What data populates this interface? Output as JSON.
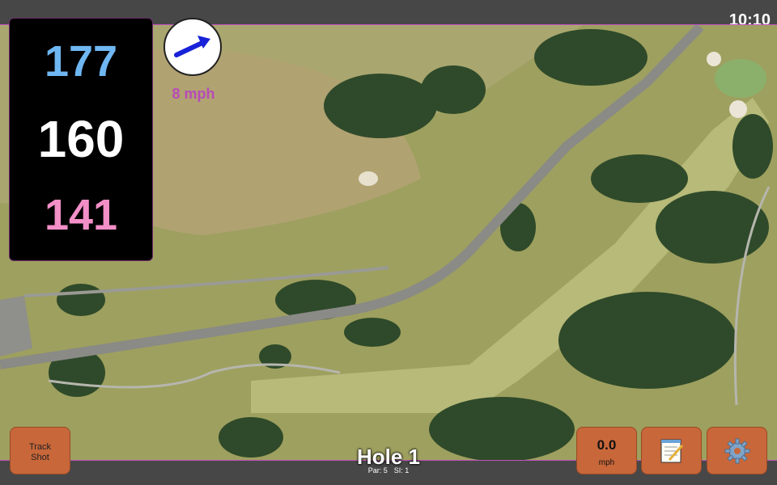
{
  "status": {
    "time": "10:10"
  },
  "distances": {
    "back": "177",
    "middle": "160",
    "front": "141",
    "colors": {
      "back": "#6fb7f3",
      "middle": "#ffffff",
      "front": "#f38fc7"
    }
  },
  "wind": {
    "speed_label": "8 mph",
    "arrow_icon": "arrow-right-icon",
    "color": "#b84bb8"
  },
  "hole": {
    "title": "Hole 1",
    "par": "Par: 5",
    "stroke_index": "SI: 1"
  },
  "buttons": {
    "track_shot_line1": "Track",
    "track_shot_line2": "Shot",
    "speed_value": "0.0",
    "speed_unit": "mph",
    "notes_icon": "notepad-icon",
    "settings_icon": "gear-icon"
  },
  "theme": {
    "button_color": "#c8673a",
    "panel_border": "#c050c0"
  }
}
